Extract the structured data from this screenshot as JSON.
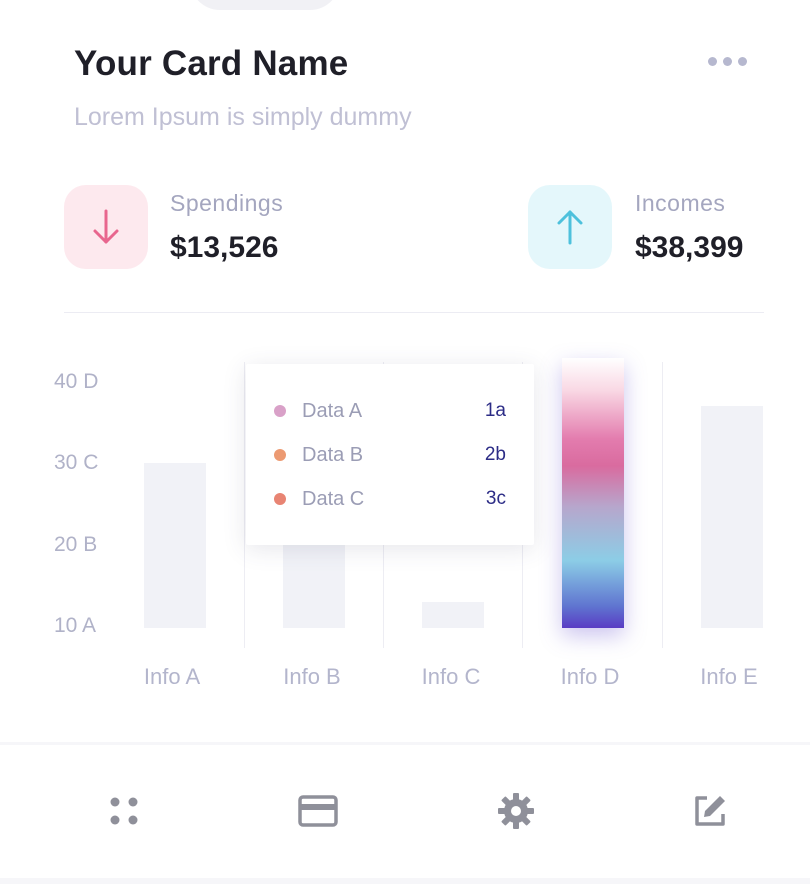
{
  "card": {
    "title": "Your Card Name",
    "subtitle": "Lorem Ipsum is simply dummy",
    "more_icon": "more-horizontal-icon"
  },
  "stats": {
    "spendings": {
      "label": "Spendings",
      "value": "$13,526",
      "icon": "arrow-down-icon",
      "color": "#e8668e"
    },
    "incomes": {
      "label": "Incomes",
      "value": "$38,399",
      "icon": "arrow-up-icon",
      "color": "#4ec1dc"
    }
  },
  "chart_data": {
    "type": "bar",
    "categories": [
      "Info A",
      "Info B",
      "Info C",
      "Info D",
      "Info E"
    ],
    "y_ticks": [
      "40 D",
      "30 C",
      "20 B",
      "10 A"
    ],
    "values": [
      30,
      20,
      13,
      43,
      37
    ],
    "highlighted_category": "Info D",
    "tooltip": [
      {
        "name": "Data A",
        "value": "1a",
        "color": "#d9a1c8"
      },
      {
        "name": "Data B",
        "value": "2b",
        "color": "#ec9a72"
      },
      {
        "name": "Data C",
        "value": "3c",
        "color": "#e88473"
      }
    ]
  },
  "nav": {
    "items": [
      "grid-icon",
      "card-icon",
      "settings-icon",
      "edit-icon"
    ],
    "icon_color": "#8f909a"
  }
}
